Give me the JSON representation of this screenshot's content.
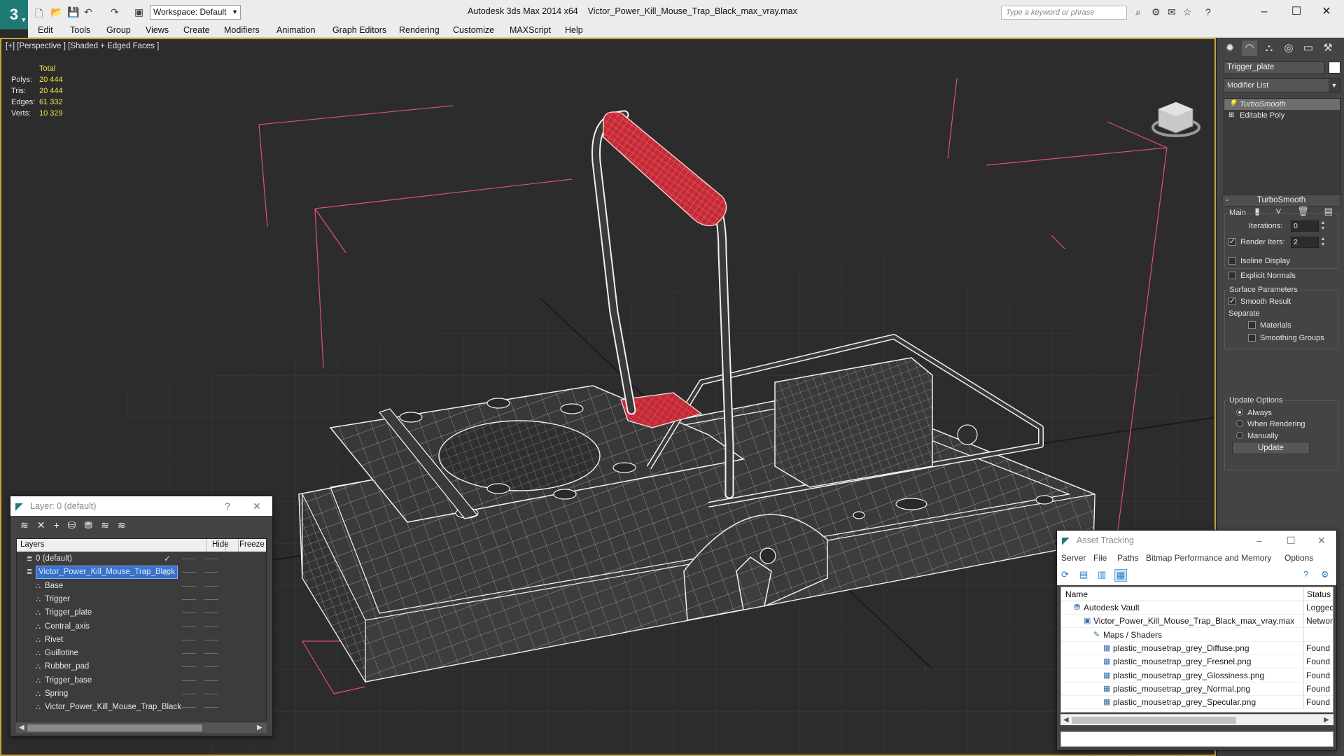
{
  "app": {
    "title": "Autodesk 3ds Max  2014 x64",
    "file": "Victor_Power_Kill_Mouse_Trap_Black_max_vray.max",
    "workspace": "Workspace: Default",
    "search_placeholder": "Type a keyword or phrase"
  },
  "menu": [
    "Edit",
    "Tools",
    "Group",
    "Views",
    "Create",
    "Modifiers",
    "Animation",
    "Graph Editors",
    "Rendering",
    "Customize",
    "MAXScript",
    "Help"
  ],
  "viewport": {
    "label": "[+] [Perspective ] [Shaded + Edged Faces ]",
    "stats": {
      "header": "Total",
      "rows": [
        {
          "k": "Polys:",
          "v": "20 444"
        },
        {
          "k": "Tris:",
          "v": "20 444"
        },
        {
          "k": "Edges:",
          "v": "61 332"
        },
        {
          "k": "Verts:",
          "v": "10 329"
        }
      ]
    }
  },
  "command_panel": {
    "object_name": "Trigger_plate",
    "object_color": "#ffffff",
    "modifier_list": "Modifier List",
    "stack": [
      "TurboSmooth",
      "Editable Poly"
    ],
    "rollout": "TurboSmooth",
    "main_group": "Main",
    "iterations_label": "Iterations:",
    "iterations_value": "0",
    "render_iters_label": "Render Iters:",
    "render_iters_value": "2",
    "render_iters_checked": true,
    "isoline": "Isoline Display",
    "explicit_normals": "Explicit Normals",
    "surface_group": "Surface Parameters",
    "smooth_result": "Smooth Result",
    "separate": "Separate",
    "materials": "Materials",
    "smoothing_groups": "Smoothing Groups",
    "update_group": "Update Options",
    "always": "Always",
    "when_rendering": "When Rendering",
    "manually": "Manually",
    "update_button": "Update"
  },
  "layer_window": {
    "title": "Layer: 0 (default)",
    "help": "?",
    "col_layers": "Layers",
    "col_hide": "Hide",
    "col_freeze": "Freeze",
    "rows": [
      {
        "name": "0 (default)",
        "level": 0,
        "type": "layer",
        "check": true
      },
      {
        "name": "Victor_Power_Kill_Mouse_Trap_Black",
        "level": 0,
        "type": "layer",
        "selected": true
      },
      {
        "name": "Base",
        "level": 1,
        "type": "object"
      },
      {
        "name": "Trigger",
        "level": 1,
        "type": "object"
      },
      {
        "name": "Trigger_plate",
        "level": 1,
        "type": "object"
      },
      {
        "name": "Central_axis",
        "level": 1,
        "type": "object"
      },
      {
        "name": "Rivet",
        "level": 1,
        "type": "object"
      },
      {
        "name": "Guillotine",
        "level": 1,
        "type": "object"
      },
      {
        "name": "Rubber_pad",
        "level": 1,
        "type": "object"
      },
      {
        "name": "Trigger_base",
        "level": 1,
        "type": "object"
      },
      {
        "name": "Spring",
        "level": 1,
        "type": "object"
      },
      {
        "name": "Victor_Power_Kill_Mouse_Trap_Black",
        "level": 1,
        "type": "object"
      }
    ]
  },
  "asset_window": {
    "title": "Asset Tracking",
    "menu": [
      "Server",
      "File",
      "Paths",
      "Bitmap Performance and Memory",
      "Options"
    ],
    "col_name": "Name",
    "col_status": "Status",
    "rows": [
      {
        "name": "Autodesk Vault",
        "status": "Logged",
        "level": 0
      },
      {
        "name": "Victor_Power_Kill_Mouse_Trap_Black_max_vray.max",
        "status": "Network",
        "level": 1
      },
      {
        "name": "Maps / Shaders",
        "status": "",
        "level": 2
      },
      {
        "name": "plastic_mousetrap_grey_Diffuse.png",
        "status": "Found",
        "level": 3
      },
      {
        "name": "plastic_mousetrap_grey_Fresnel.png",
        "status": "Found",
        "level": 3
      },
      {
        "name": "plastic_mousetrap_grey_Glossiness.png",
        "status": "Found",
        "level": 3
      },
      {
        "name": "plastic_mousetrap_grey_Normal.png",
        "status": "Found",
        "level": 3
      },
      {
        "name": "plastic_mousetrap_grey_Specular.png",
        "status": "Found",
        "level": 3
      }
    ]
  },
  "colors": {
    "accent": "#1e7a75",
    "viewport_border": "#c8a53a",
    "stats_value": "#f3e64a",
    "selection": "#3a72c8",
    "wire_highlight": "#e0404a"
  }
}
